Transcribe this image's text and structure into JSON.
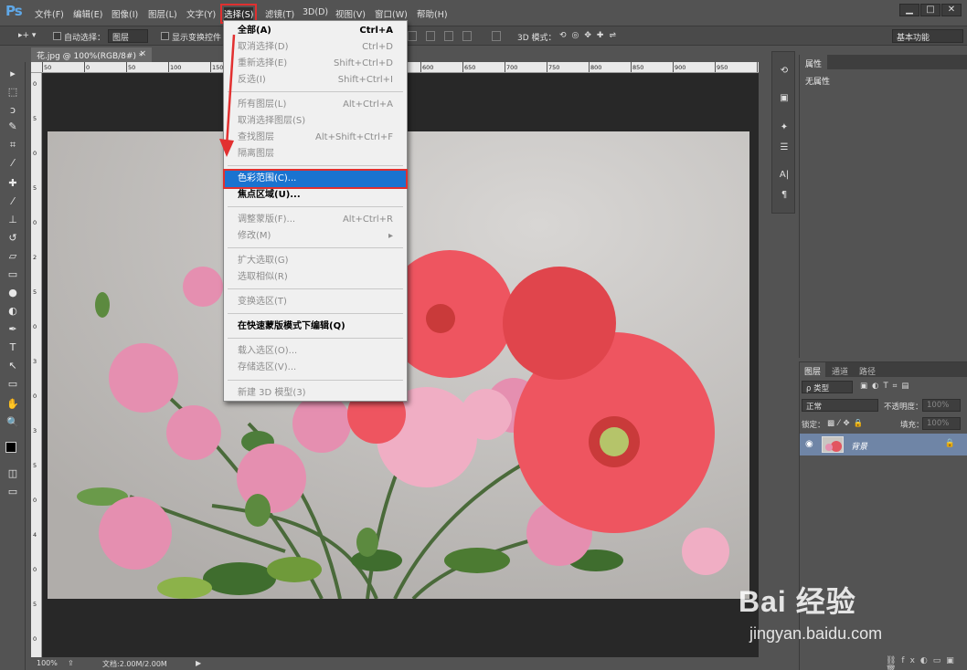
{
  "app": {
    "logo": "Ps"
  },
  "menubar": {
    "items": [
      "文件(F)",
      "编辑(E)",
      "图像(I)",
      "图层(L)",
      "文字(Y)",
      "选择(S)",
      "滤镜(T)",
      "3D(D)",
      "视图(V)",
      "窗口(W)",
      "帮助(H)"
    ],
    "window_controls": [
      "▁",
      "□",
      "✕"
    ]
  },
  "options": {
    "auto_select_label": "自动选择：",
    "auto_select_value": "图层",
    "show_transform_label": "显示变换控件",
    "mode_3d_label": "3D 模式：",
    "workspace": "基本功能"
  },
  "document": {
    "tab_title": "花.jpg @ 100%(RGB/8#) *",
    "tab_close": "×"
  },
  "ruler": {
    "top_ticks": [
      "50",
      "0",
      "50",
      "100",
      "150",
      "200",
      "250",
      "500",
      "550",
      "600",
      "650",
      "700",
      "750",
      "800",
      "850",
      "900",
      "950",
      "1000"
    ],
    "left_ticks": [
      "0",
      "5",
      "0",
      "5",
      "0",
      "2",
      "5",
      "0",
      "3",
      "0",
      "3",
      "5",
      "0",
      "4",
      "0",
      "5",
      "0"
    ]
  },
  "status": {
    "zoom": "100%",
    "doc_size": "文档:2.00M/2.00M",
    "arrow": "▶"
  },
  "tools": [
    "move-tool",
    "marquee-tool",
    "lasso-tool",
    "quick-select-tool",
    "crop-tool",
    "eyedropper-tool",
    "healing-tool",
    "brush-tool",
    "stamp-tool",
    "history-brush-tool",
    "eraser-tool",
    "gradient-tool",
    "blur-tool",
    "dodge-tool",
    "pen-tool",
    "type-tool",
    "path-select-tool",
    "shape-tool",
    "hand-tool",
    "zoom-tool"
  ],
  "tool_glyphs": [
    "▸",
    "⬚",
    "ↄ",
    "✎",
    "⌗",
    "⁄",
    "✚",
    "⁄",
    "⊥",
    "↺",
    "▱",
    "▭",
    "●",
    "◐",
    "✒",
    "T",
    "↖",
    "▭",
    "✋",
    "🔍"
  ],
  "select_menu": {
    "items": [
      {
        "label": "全部(A)",
        "shortcut": "Ctrl+A",
        "state": "normal"
      },
      {
        "label": "取消选择(D)",
        "shortcut": "Ctrl+D",
        "state": "disabled"
      },
      {
        "label": "重新选择(E)",
        "shortcut": "Shift+Ctrl+D",
        "state": "disabled"
      },
      {
        "label": "反选(I)",
        "shortcut": "Shift+Ctrl+I",
        "state": "disabled"
      },
      {
        "label": "所有图层(L)",
        "shortcut": "Alt+Ctrl+A",
        "state": "disabled"
      },
      {
        "label": "取消选择图层(S)",
        "shortcut": "",
        "state": "disabled"
      },
      {
        "label": "查找图层",
        "shortcut": "Alt+Shift+Ctrl+F",
        "state": "disabled"
      },
      {
        "label": "隔离图层",
        "shortcut": "",
        "state": "disabled"
      },
      {
        "label": "色彩范围(C)...",
        "shortcut": "",
        "state": "highlighted"
      },
      {
        "label": "焦点区域(U)...",
        "shortcut": "",
        "state": "normal"
      },
      {
        "label": "调整蒙版(F)...",
        "shortcut": "Alt+Ctrl+R",
        "state": "disabled"
      },
      {
        "label": "修改(M)",
        "shortcut": "▸",
        "state": "disabled"
      },
      {
        "label": "扩大选取(G)",
        "shortcut": "",
        "state": "disabled"
      },
      {
        "label": "选取相似(R)",
        "shortcut": "",
        "state": "disabled"
      },
      {
        "label": "变换选区(T)",
        "shortcut": "",
        "state": "disabled"
      },
      {
        "label": "在快速蒙版模式下编辑(Q)",
        "shortcut": "",
        "state": "normal"
      },
      {
        "label": "载入选区(O)...",
        "shortcut": "",
        "state": "disabled"
      },
      {
        "label": "存储选区(V)...",
        "shortcut": "",
        "state": "disabled"
      },
      {
        "label": "新建 3D 模型(3)",
        "shortcut": "",
        "state": "disabled"
      }
    ]
  },
  "properties": {
    "tab": "属性",
    "empty": "无属性"
  },
  "layers": {
    "tabs": [
      "图层",
      "通道",
      "路径"
    ],
    "filter_label": "ρ 类型",
    "blend_mode": "正常",
    "opacity_label": "不透明度：",
    "opacity_value": "100%",
    "lock_label": "锁定：",
    "fill_label": "填充：",
    "fill_value": "100%",
    "layer_name": "背景"
  },
  "colors": {
    "accent": "#1a73d0",
    "highlight_border": "#e03030",
    "layer_selected": "#6f85a6"
  },
  "watermark": {
    "logo": "Bai 经验",
    "url": "jingyan.baidu.com"
  }
}
